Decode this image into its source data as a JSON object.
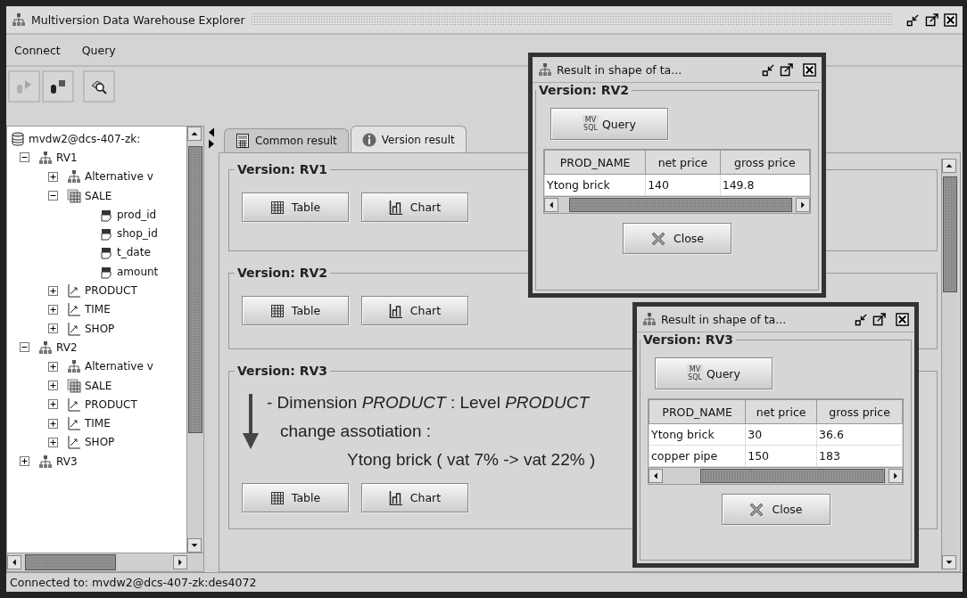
{
  "window": {
    "title": "Multiversion Data Warehouse Explorer"
  },
  "menu": [
    {
      "label": "Connect"
    },
    {
      "label": "Query"
    }
  ],
  "toolbar": [
    {
      "kind": "connect",
      "disabled": true
    },
    {
      "kind": "disconnect",
      "disabled": false
    },
    {
      "kind": "query",
      "disabled": false
    }
  ],
  "tree": {
    "label": "mvdw2@dcs-407-zk:",
    "kind": "database",
    "children": [
      {
        "label": "RV1",
        "kind": "version",
        "expanded": true,
        "children": [
          {
            "label": "Alternative v",
            "kind": "version",
            "expanded": false
          },
          {
            "label": "SALE",
            "kind": "table",
            "expanded": true,
            "children": [
              {
                "label": "prod_id",
                "kind": "column"
              },
              {
                "label": "shop_id",
                "kind": "column"
              },
              {
                "label": "t_date",
                "kind": "column"
              },
              {
                "label": "amount",
                "kind": "column"
              }
            ]
          },
          {
            "label": "PRODUCT",
            "kind": "dimension",
            "expanded": false
          },
          {
            "label": "TIME",
            "kind": "dimension",
            "expanded": false
          },
          {
            "label": "SHOP",
            "kind": "dimension",
            "expanded": false
          }
        ]
      },
      {
        "label": "RV2",
        "kind": "version",
        "expanded": true,
        "children": [
          {
            "label": "Alternative v",
            "kind": "version",
            "expanded": false
          },
          {
            "label": "SALE",
            "kind": "table",
            "expanded": false
          },
          {
            "label": "PRODUCT",
            "kind": "dimension",
            "expanded": false
          },
          {
            "label": "TIME",
            "kind": "dimension",
            "expanded": false
          },
          {
            "label": "SHOP",
            "kind": "dimension",
            "expanded": false
          }
        ]
      },
      {
        "label": "RV3",
        "kind": "version",
        "expanded": false
      }
    ]
  },
  "tabs": [
    {
      "label": "Common result",
      "kind": "calculator",
      "selected": false
    },
    {
      "label": "Version result",
      "kind": "info",
      "selected": true
    }
  ],
  "versions": [
    {
      "title": "Version: RV1",
      "buttons": [
        {
          "label": "Table",
          "kind": "table"
        },
        {
          "label": "Chart",
          "kind": "chart"
        }
      ]
    },
    {
      "title": "Version: RV2",
      "buttons": [
        {
          "label": "Table",
          "kind": "table"
        },
        {
          "label": "Chart",
          "kind": "chart"
        }
      ]
    },
    {
      "title": "Version: RV3",
      "note": [
        {
          "text": "- Dimension *PRODUCT* : Level *PRODUCT*",
          "kind": "heading"
        },
        {
          "text": "change assotiation :",
          "kind": "plain"
        },
        {
          "text": "Ytong brick ( vat 7% -> vat 22% )",
          "kind": "detail"
        }
      ],
      "buttons": [
        {
          "label": "Table",
          "kind": "table"
        },
        {
          "label": "Chart",
          "kind": "chart"
        }
      ]
    }
  ],
  "result_windows": [
    {
      "title": "Result in shape of ta...",
      "version": "Version: RV2",
      "query_button": {
        "label": "Query",
        "icon_lines": [
          "MV",
          "SQL"
        ]
      },
      "table": {
        "columns": [
          "PROD_NAME",
          "net price",
          "gross price"
        ],
        "rows": [
          [
            "Ytong brick",
            "140",
            "149.8"
          ]
        ]
      },
      "close_button": "Close"
    },
    {
      "title": "Result in shape of ta...",
      "version": "Version: RV3",
      "query_button": {
        "label": "Query",
        "icon_lines": [
          "MV",
          "SQL"
        ]
      },
      "table": {
        "columns": [
          "PROD_NAME",
          "net price",
          "gross price"
        ],
        "rows": [
          [
            "Ytong brick",
            "30",
            "36.6"
          ],
          [
            "copper pipe",
            "150",
            "183"
          ]
        ]
      },
      "close_button": "Close"
    }
  ],
  "status_bar": "Connected to: mvdw2@dcs-407-zk:des4072"
}
